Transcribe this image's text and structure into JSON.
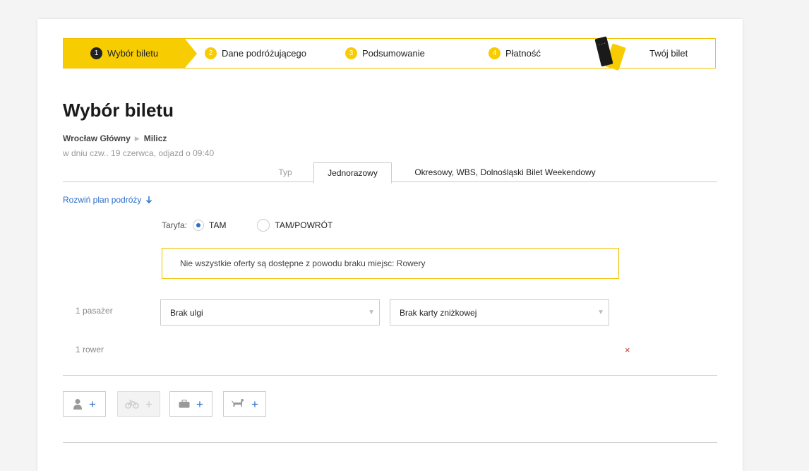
{
  "stepper": {
    "steps": [
      {
        "num": "1",
        "label": "Wybór biletu"
      },
      {
        "num": "2",
        "label": "Dane podróżującego"
      },
      {
        "num": "3",
        "label": "Podsumowanie"
      },
      {
        "num": "4",
        "label": "Płatność"
      },
      {
        "label": "Twój bilet"
      }
    ]
  },
  "page": {
    "title": "Wybór biletu",
    "route_from": "Wrocław Główny",
    "route_to": "Milicz",
    "date": "w dniu czw.. 19 czerwca, odjazd o 09:40"
  },
  "tabs": {
    "type_label": "Typ",
    "items": [
      "Jednorazowy",
      "Okresowy, WBS, Dolnośląski Bilet Weekendowy"
    ]
  },
  "expand_link": "Rozwiń plan podróży",
  "fare": {
    "label": "Taryfa:",
    "options": [
      "TAM",
      "TAM/POWRÓT"
    ]
  },
  "notice": "Nie wszystkie oferty są dostępne z powodu braku miejsc: Rowery",
  "passengers": {
    "passenger_label": "1 pasażer",
    "discount": "Brak ulgi",
    "card": "Brak karty zniżkowej",
    "bike_label": "1 rower",
    "remove": "×"
  },
  "add_buttons": {
    "plus": "+",
    "icons": [
      "person-icon",
      "bike-icon",
      "luggage-icon",
      "dog-icon"
    ]
  },
  "colors": {
    "accent": "#f7cc00",
    "link": "#2a6fc9",
    "remove": "#c0392b"
  }
}
